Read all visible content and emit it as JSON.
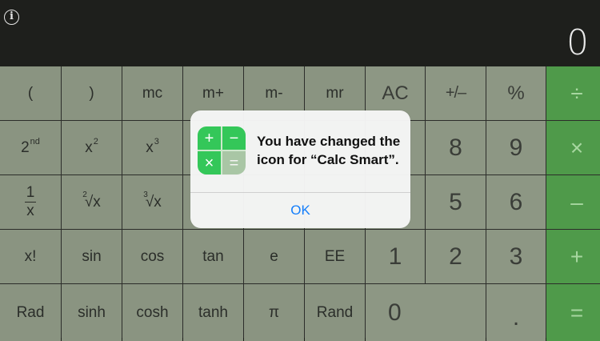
{
  "display": {
    "info_icon": "info-icon",
    "info_glyph": "i",
    "value": "0"
  },
  "keys": {
    "open_paren": "(",
    "close_paren": ")",
    "mc": "mc",
    "m_plus": "m+",
    "m_minus": "m-",
    "mr": "mr",
    "ac": "AC",
    "plus_minus": "+/–",
    "percent": "%",
    "divide": "÷",
    "second": {
      "base": "2",
      "sup": "nd"
    },
    "x_squared": {
      "base": "x",
      "sup": "2"
    },
    "x_cubed": {
      "base": "x",
      "sup": "3"
    },
    "eight": "8",
    "nine": "9",
    "multiply": "×",
    "reciprocal": {
      "numerator": "1",
      "denominator": "x"
    },
    "square_root": {
      "index": "2",
      "body": "√x"
    },
    "cube_root": {
      "index": "3",
      "body": "√x"
    },
    "five": "5",
    "six": "6",
    "minus": "–",
    "factorial": "x!",
    "sin": "sin",
    "cos": "cos",
    "tan": "tan",
    "e": "e",
    "ee": "EE",
    "one": "1",
    "two": "2",
    "three": "3",
    "plus": "+",
    "rad": "Rad",
    "sinh": "sinh",
    "cosh": "cosh",
    "tanh": "tanh",
    "pi": "π",
    "rand": "Rand",
    "zero": "0",
    "dot": ".",
    "equals": "="
  },
  "alert": {
    "icon": "calc-smart-app-icon",
    "icon_glyphs": {
      "plus": "+",
      "minus": "−",
      "times": "×",
      "equals": "="
    },
    "message": "You have changed the icon for “Calc Smart”.",
    "ok_label": "OK"
  },
  "colors": {
    "display_bg": "#1e1f1c",
    "key_bg": "#8a9481",
    "operator_bg": "#4f9a4a",
    "alert_button": "#147efb",
    "app_icon_green": "#34c759"
  }
}
